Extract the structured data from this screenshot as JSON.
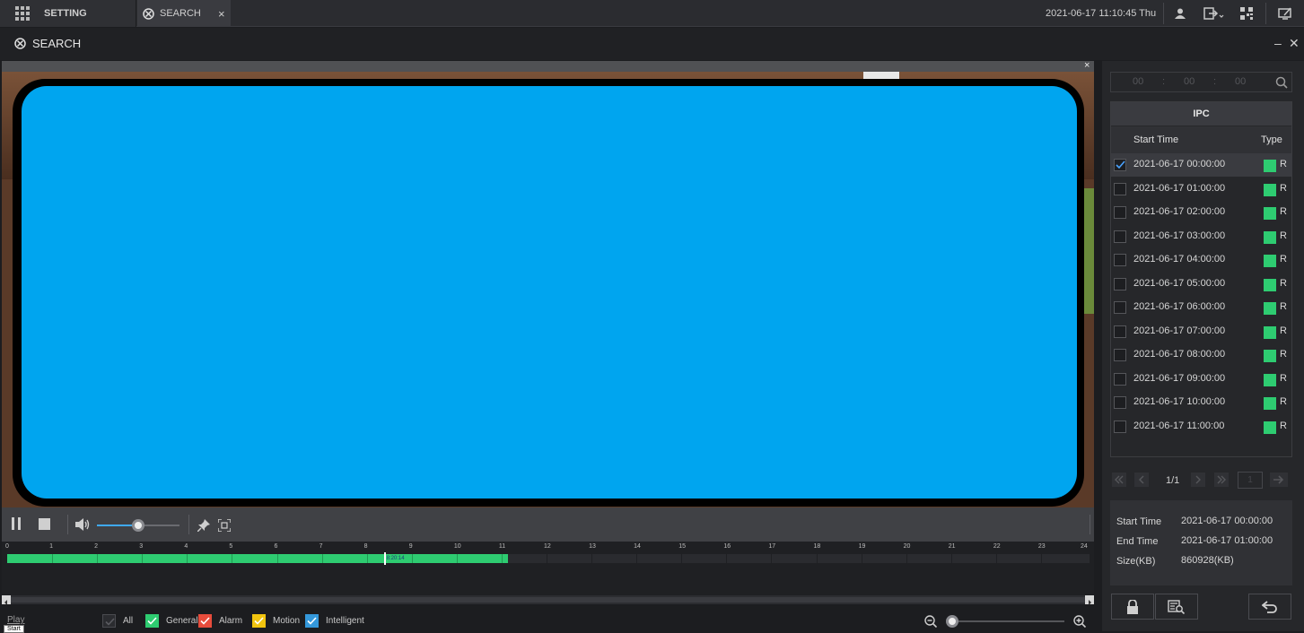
{
  "topbar": {
    "setting_label": "SETTING",
    "search_tab_label": "SEARCH",
    "tab_close": "×",
    "datetime": "2021-06-17 11:10:45 Thu"
  },
  "titlebar": {
    "title": "SEARCH",
    "minimize": "–",
    "close": "✕"
  },
  "video": {
    "close": "×"
  },
  "controls": {
    "volume_level": 0.5
  },
  "timeline": {
    "ticks": [
      "0",
      "1",
      "2",
      "3",
      "4",
      "5",
      "6",
      "7",
      "8",
      "9",
      "10",
      "11",
      "12",
      "13",
      "14",
      "15",
      "16",
      "17",
      "18",
      "19",
      "20",
      "21",
      "22",
      "23",
      "24"
    ],
    "recorded_until_hour": 11.1,
    "cursor_hour": 8.35,
    "cursor_label": "8:20:14"
  },
  "bottom": {
    "play_label": "Play",
    "start_tooltip": "Start",
    "legend": [
      {
        "label": "All",
        "color": "#2b2c30",
        "checked": false
      },
      {
        "label": "General",
        "color": "#2ecc71",
        "checked": true
      },
      {
        "label": "Alarm",
        "color": "#e74c3c",
        "checked": true
      },
      {
        "label": "Motion",
        "color": "#f1c40f",
        "checked": true
      },
      {
        "label": "Intelligent",
        "color": "#3498db",
        "checked": true
      }
    ],
    "zoom_level": 0.0
  },
  "search": {
    "time_parts": [
      "00",
      "00",
      "00"
    ]
  },
  "table": {
    "title": "IPC",
    "col_start": "Start Time",
    "col_type": "Type",
    "rows": [
      {
        "start": "2021-06-17 00:00:00",
        "type": "R",
        "checked": true
      },
      {
        "start": "2021-06-17 01:00:00",
        "type": "R",
        "checked": false
      },
      {
        "start": "2021-06-17 02:00:00",
        "type": "R",
        "checked": false
      },
      {
        "start": "2021-06-17 03:00:00",
        "type": "R",
        "checked": false
      },
      {
        "start": "2021-06-17 04:00:00",
        "type": "R",
        "checked": false
      },
      {
        "start": "2021-06-17 05:00:00",
        "type": "R",
        "checked": false
      },
      {
        "start": "2021-06-17 06:00:00",
        "type": "R",
        "checked": false
      },
      {
        "start": "2021-06-17 07:00:00",
        "type": "R",
        "checked": false
      },
      {
        "start": "2021-06-17 08:00:00",
        "type": "R",
        "checked": false
      },
      {
        "start": "2021-06-17 09:00:00",
        "type": "R",
        "checked": false
      },
      {
        "start": "2021-06-17 10:00:00",
        "type": "R",
        "checked": false
      },
      {
        "start": "2021-06-17 11:00:00",
        "type": "R",
        "checked": false
      }
    ]
  },
  "pager": {
    "page": "1/1",
    "goto_value": "1"
  },
  "details": {
    "start_label": "Start Time",
    "start_value": "2021-06-17 00:00:00",
    "end_label": "End Time",
    "end_value": "2021-06-17 01:00:00",
    "size_label": "Size(KB)",
    "size_value": "860928(KB)"
  }
}
